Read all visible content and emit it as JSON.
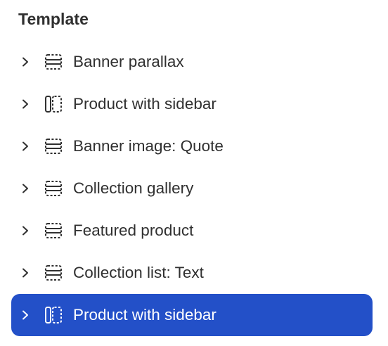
{
  "section": {
    "title": "Template"
  },
  "items": [
    {
      "label": "Banner parallax",
      "icon": "banner-section-icon",
      "selected": false
    },
    {
      "label": "Product with sidebar",
      "icon": "sidebar-section-icon",
      "selected": false
    },
    {
      "label": "Banner image: Quote",
      "icon": "banner-section-icon",
      "selected": false
    },
    {
      "label": "Collection gallery",
      "icon": "banner-section-icon",
      "selected": false
    },
    {
      "label": "Featured product",
      "icon": "banner-section-icon",
      "selected": false
    },
    {
      "label": "Collection list: Text",
      "icon": "banner-section-icon",
      "selected": false
    },
    {
      "label": "Product with sidebar",
      "icon": "sidebar-section-icon",
      "selected": true
    }
  ],
  "colors": {
    "selected_bg": "#2350c8",
    "text": "#303030",
    "selected_text": "#ffffff"
  }
}
